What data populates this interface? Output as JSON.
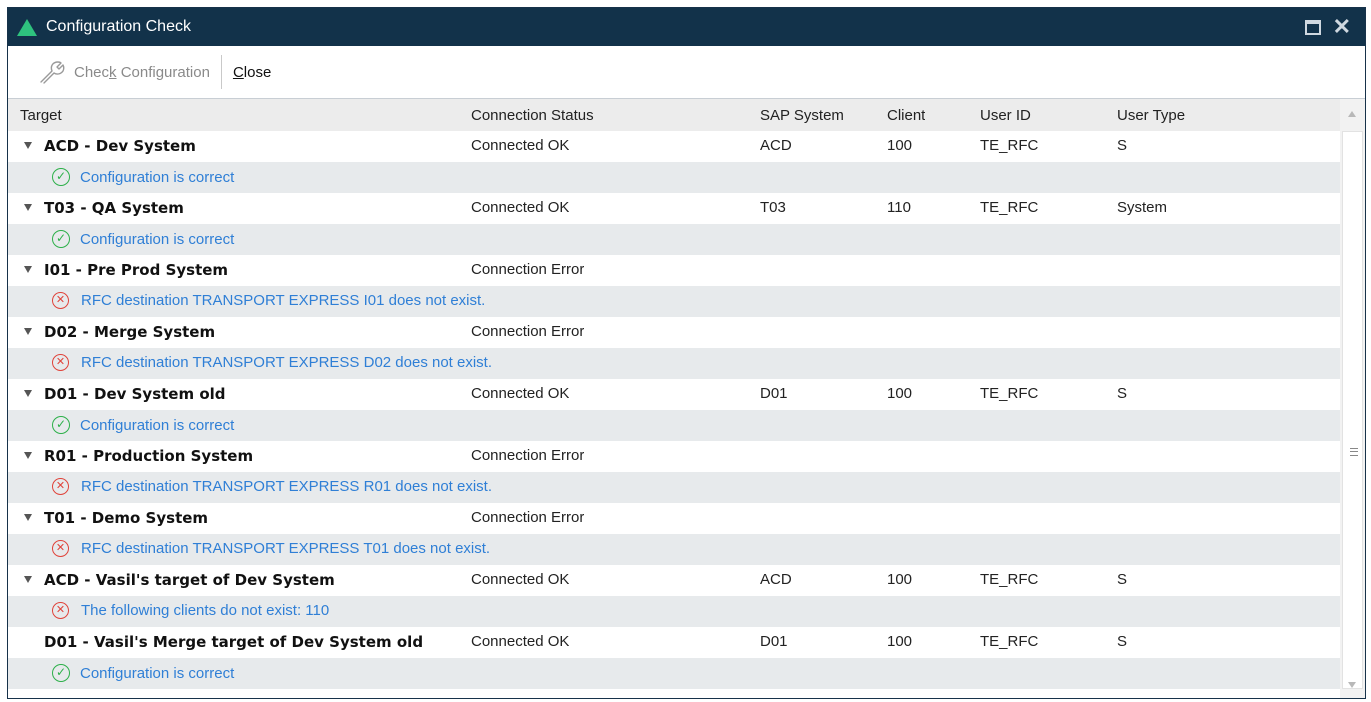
{
  "window": {
    "title": "Configuration Check"
  },
  "toolbar": {
    "check_label_a": "Chec",
    "check_label_k": "k",
    "check_label_b": " Configuration",
    "close_label_c": "C",
    "close_label_rest": "lose"
  },
  "columns": {
    "target": "Target",
    "status": "Connection Status",
    "sap": "SAP System",
    "client": "Client",
    "user": "User ID",
    "type": "User Type"
  },
  "rows": [
    {
      "target": "ACD - Dev System",
      "status": "Connected OK",
      "sap": "ACD",
      "client": "100",
      "user": "TE_RFC",
      "type": "S",
      "message": "Configuration is correct",
      "result": "ok"
    },
    {
      "target": "T03 - QA System",
      "status": "Connected OK",
      "sap": "T03",
      "client": "110",
      "user": "TE_RFC",
      "type": "System",
      "message": "Configuration is correct",
      "result": "ok"
    },
    {
      "target": "I01 - Pre Prod System",
      "status": "Connection Error",
      "sap": "",
      "client": "",
      "user": "",
      "type": "",
      "message": "RFC destination TRANSPORT EXPRESS I01 does not exist.",
      "result": "error"
    },
    {
      "target": "D02 - Merge System",
      "status": "Connection Error",
      "sap": "",
      "client": "",
      "user": "",
      "type": "",
      "message": "RFC destination TRANSPORT EXPRESS D02 does not exist.",
      "result": "error"
    },
    {
      "target": "D01 - Dev System old",
      "status": "Connected OK",
      "sap": "D01",
      "client": "100",
      "user": "TE_RFC",
      "type": "S",
      "message": "Configuration is correct",
      "result": "ok"
    },
    {
      "target": "R01 - Production System",
      "status": "Connection Error",
      "sap": "",
      "client": "",
      "user": "",
      "type": "",
      "message": "RFC destination TRANSPORT EXPRESS R01 does not exist.",
      "result": "error"
    },
    {
      "target": "T01 - Demo System",
      "status": "Connection Error",
      "sap": "",
      "client": "",
      "user": "",
      "type": "",
      "message": "RFC destination TRANSPORT EXPRESS T01 does not exist.",
      "result": "error"
    },
    {
      "target": "ACD - Vasil's target of Dev System",
      "status": "Connected OK",
      "sap": "ACD",
      "client": "100",
      "user": "TE_RFC",
      "type": "S",
      "message": "The following clients do not exist: 110",
      "result": "error"
    },
    {
      "target": "D01 - Vasil's Merge target of Dev System old",
      "status": "Connected OK",
      "sap": "D01",
      "client": "100",
      "user": "TE_RFC",
      "type": "S",
      "message": "Configuration is correct",
      "result": "ok"
    }
  ],
  "icons": {
    "ok": "check-circle-icon",
    "error": "x-circle-icon"
  },
  "colors": {
    "titlebar": "#12324a",
    "accent": "#2ec27e",
    "message": "#2f7fd6",
    "ok": "#2db04a",
    "error": "#e0433a"
  }
}
